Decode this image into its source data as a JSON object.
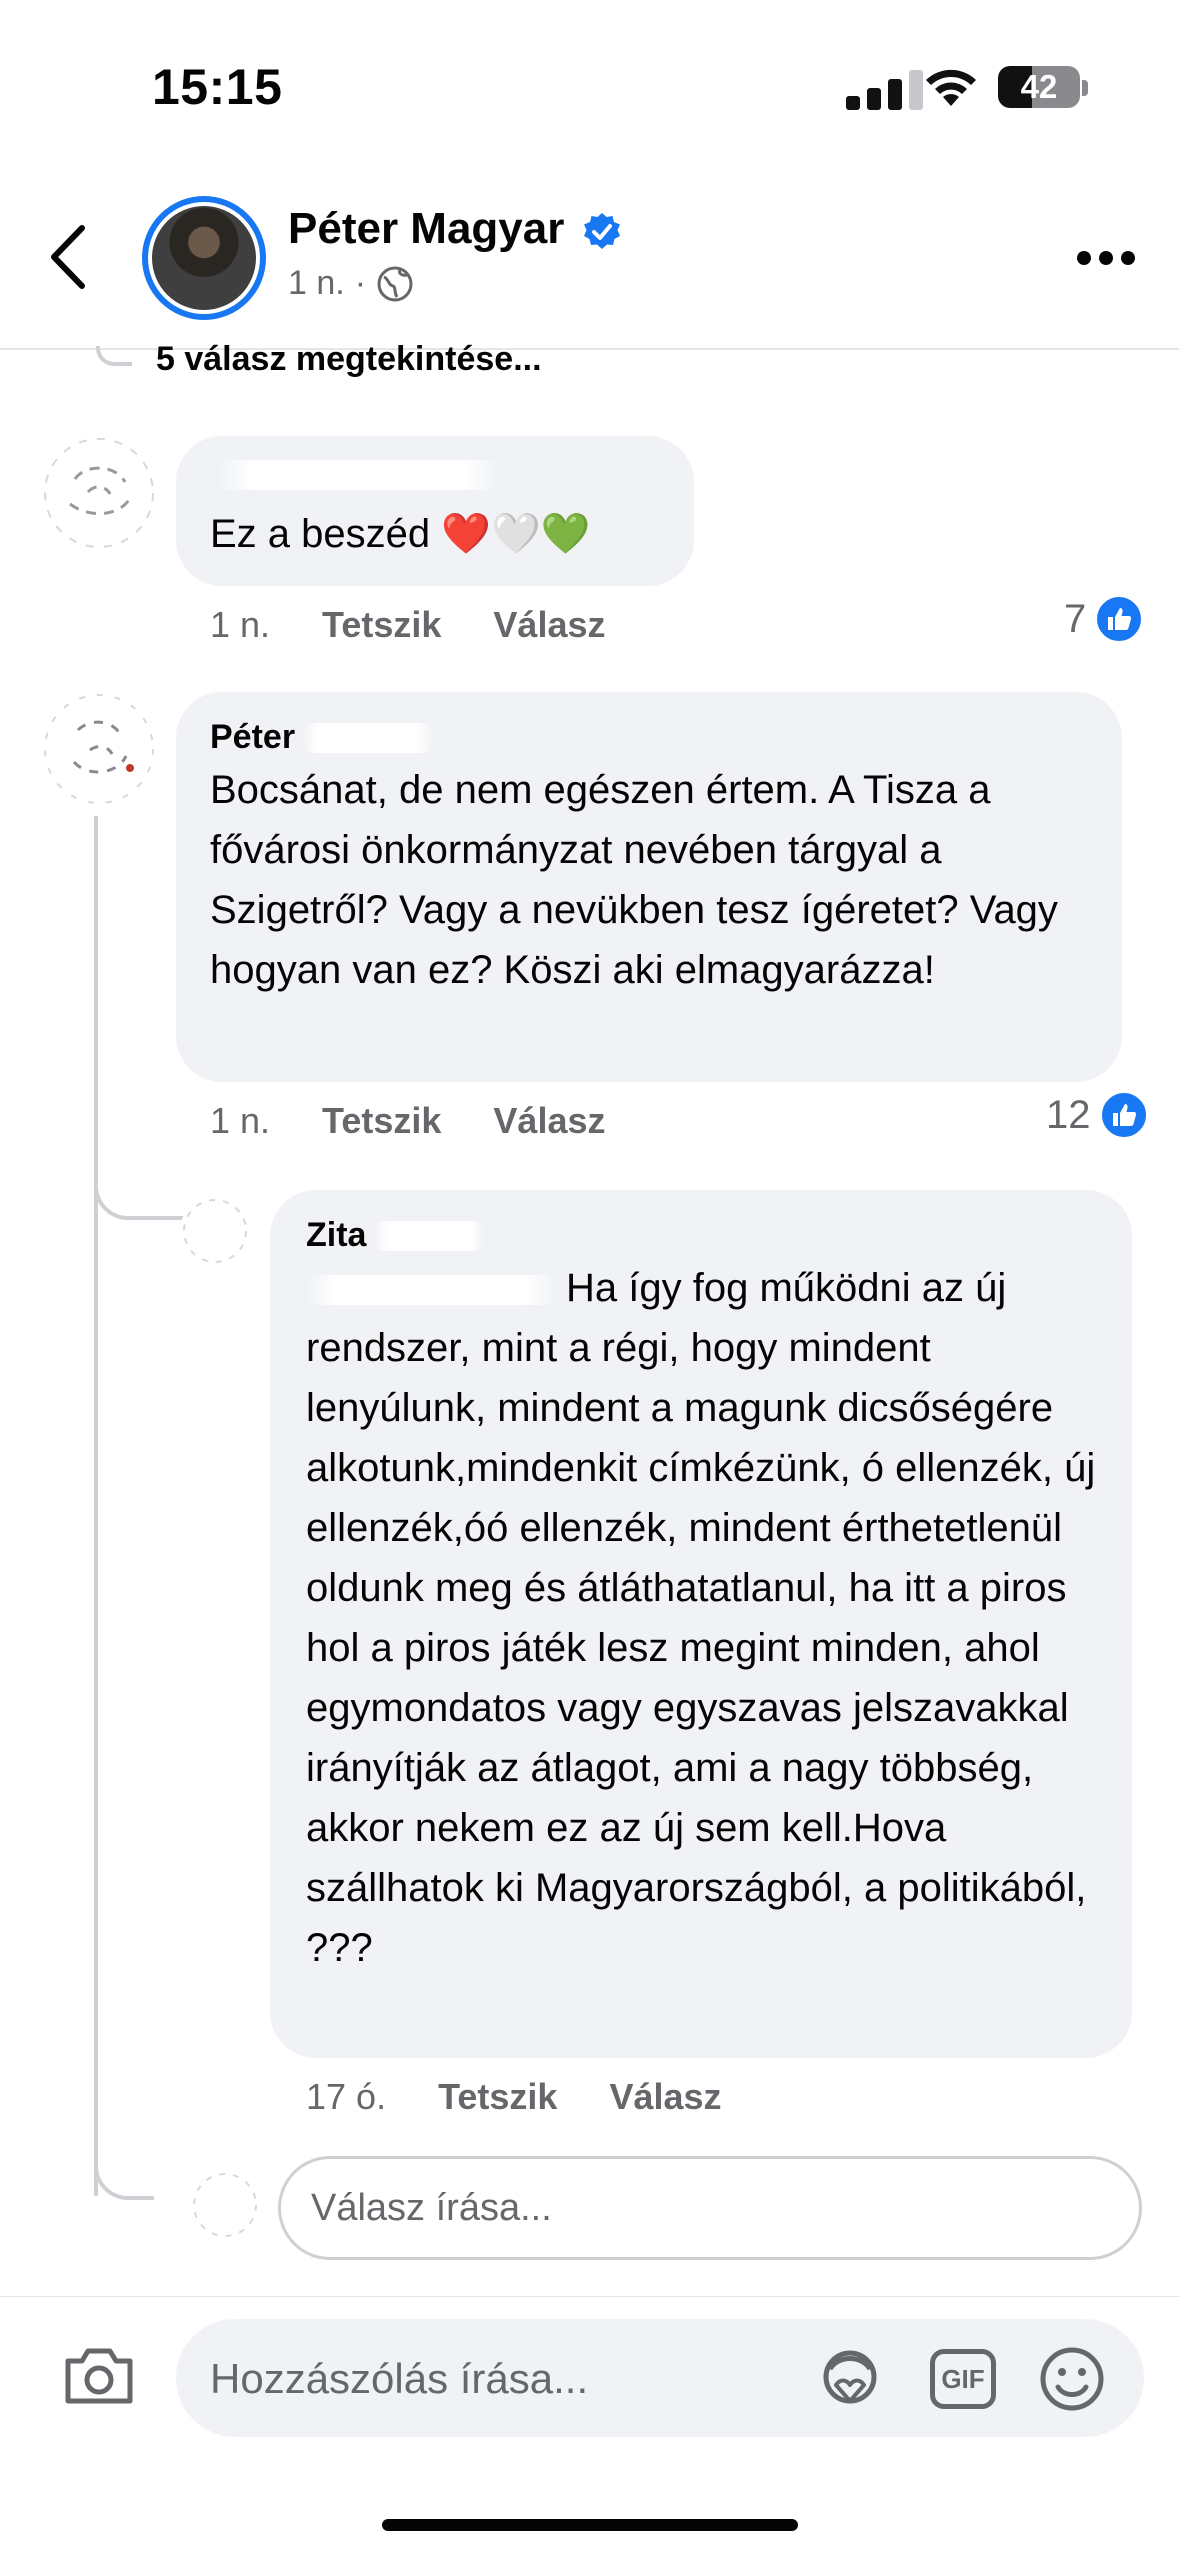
{
  "status_bar": {
    "time": "15:15",
    "battery": "42",
    "battery_level_pct": 42
  },
  "header": {
    "name": "Péter Magyar",
    "time": "1 n.",
    "separator": "·"
  },
  "thread_partial": "5 válasz megtekintése...",
  "comments": [
    {
      "author": "",
      "text": "Ez a beszéd ❤️🤍💚",
      "time": "1 n.",
      "like_label": "Tetszik",
      "reply_label": "Válasz",
      "likes": "7"
    },
    {
      "author": "Péter",
      "text": "Bocsánat, de nem egészen értem. A Tisza a fővárosi önkormányzat nevében tárgyal a Szigetről? Vagy a nevükben tesz ígéretet? Vagy hogyan van ez? Köszi aki elmagyarázza!",
      "time": "1 n.",
      "like_label": "Tetszik",
      "reply_label": "Válasz",
      "likes": "12"
    },
    {
      "author": "Zita",
      "text": "Ha így fog működni az új rendszer, mint a régi, hogy mindent lenyúlunk, mindent a magunk dicsőségére alkotunk,mindenkit címkézünk, ó ellenzék, új ellenzék,óó ellenzék, mindent érthetetlenül oldunk meg és átláthatatlanul, ha itt a piros hol a piros játék lesz megint minden, ahol egymondatos vagy egyszavas jelszavakkal irányítják az átlagot, ami a nagy többség, akkor nekem ez az új sem kell.Hova szállhatok ki Magyarországból, a politikából, ???",
      "time": "17 ó.",
      "like_label": "Tetszik",
      "reply_label": "Válasz"
    }
  ],
  "reply_input": {
    "placeholder": "Válasz írása..."
  },
  "composer": {
    "placeholder": "Hozzászólás írása...",
    "gif_label": "GIF"
  },
  "colors": {
    "accent": "#1877f2",
    "bubble": "#f0f2f5",
    "secondary_text": "#65676b"
  }
}
